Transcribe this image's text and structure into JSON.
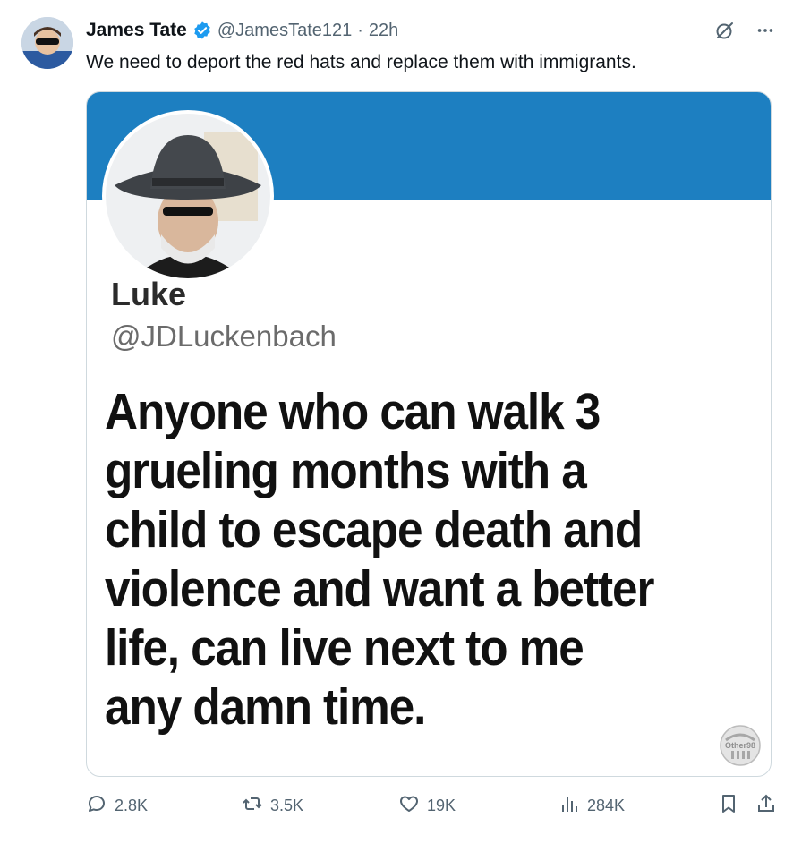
{
  "author": {
    "name": "James Tate",
    "handle": "@JamesTate121",
    "separator": "·",
    "time": "22h"
  },
  "tweet": {
    "text": "We need to deport the red hats and replace them with immigrants."
  },
  "embedded": {
    "name": "Luke",
    "handle": "@JDLuckenbach",
    "body": "Anyone who can walk 3\ngrueling months with a\nchild to escape death and\nviolence and want a better\nlife, can live next to me\nany damn time.",
    "banner_color": "#1d7fc1",
    "watermark_text": "Other98"
  },
  "actions": {
    "replies": "2.8K",
    "reposts": "3.5K",
    "likes": "19K",
    "views": "284K"
  },
  "icons": [
    "verified-badge-icon",
    "grok-icon",
    "more-icon",
    "reply-icon",
    "repost-icon",
    "like-icon",
    "views-icon",
    "bookmark-icon",
    "share-icon"
  ],
  "colors": {
    "text": "#0f1419",
    "secondary": "#536471",
    "verified": "#1d9bf0"
  }
}
